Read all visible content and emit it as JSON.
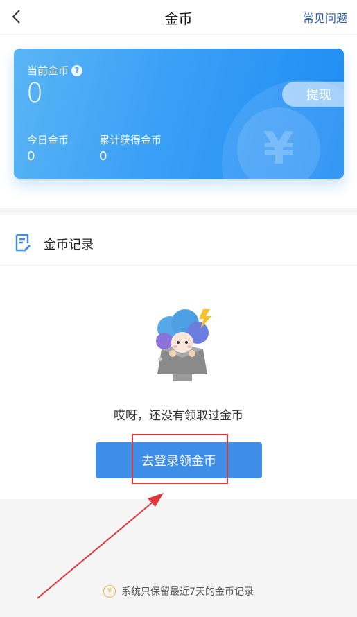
{
  "header": {
    "title": "金币",
    "faq_label": "常见问题"
  },
  "card": {
    "current_label": "当前金币",
    "balance": "0",
    "withdraw_label": "提现",
    "today_label": "今日金币",
    "today_value": "0",
    "total_label": "累计获得金币",
    "total_value": "0",
    "deco_symbol": "¥",
    "help_symbol": "?"
  },
  "records": {
    "title": "金币记录",
    "empty_text": "哎呀，还没有领取过金币",
    "login_button": "去登录领金币"
  },
  "footer": {
    "note": "系统只保留最近7天的金币记录",
    "icon_symbol": "¥"
  },
  "colors": {
    "card_gradient_start": "#5ab5f5",
    "card_gradient_end": "#1e8cf4",
    "login_button": "#3e8ee8",
    "faq_link": "#2d5ba8",
    "annotation_red": "#e0393c"
  },
  "icons": [
    "back-icon",
    "help-icon",
    "doc-icon",
    "coin-icon",
    "mascot-illustration"
  ]
}
